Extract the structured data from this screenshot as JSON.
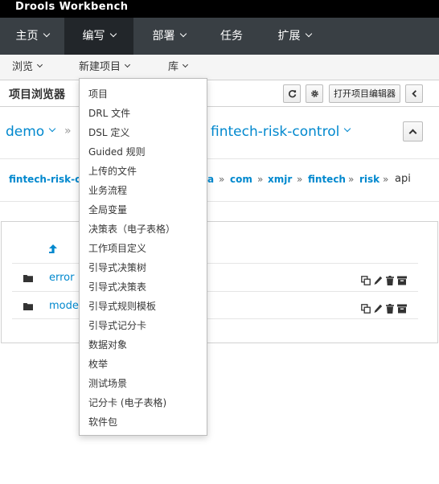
{
  "app": {
    "title": "Drools Workbench"
  },
  "main_nav": [
    {
      "label": "主页",
      "has_caret": true
    },
    {
      "label": "编写",
      "has_caret": true,
      "active": true
    },
    {
      "label": "部署",
      "has_caret": true
    },
    {
      "label": "任务",
      "has_caret": false
    },
    {
      "label": "扩展",
      "has_caret": true
    }
  ],
  "sub_nav": [
    {
      "label": "浏览"
    },
    {
      "label": "新建项目"
    },
    {
      "label": "库"
    }
  ],
  "explorer": {
    "title": "项目浏览器",
    "open_editor_label": "打开项目编辑器"
  },
  "path": {
    "org_unit": "demo",
    "project": "fintech-risk-control"
  },
  "packages": {
    "items": [
      "fintech-risk-co",
      "a",
      "com",
      "xmjr",
      "fintech",
      "risk"
    ],
    "current": "api"
  },
  "files": [
    {
      "name": "error"
    },
    {
      "name": "model"
    }
  ],
  "new_item_menu": [
    "项目",
    "DRL 文件",
    "DSL 定义",
    "Guided 规则",
    "上传的文件",
    "业务流程",
    "全局变量",
    "决策表（电子表格）",
    "工作项目定义",
    "引导式决策树",
    "引导式决策表",
    "引导式规则模板",
    "引导式记分卡",
    "数据对象",
    "枚举",
    "测试场景",
    "记分卡 (电子表格)",
    "软件包"
  ],
  "colors": {
    "link": "#0088ce",
    "nav_bg": "#393f44",
    "nav_active": "#22262a"
  }
}
